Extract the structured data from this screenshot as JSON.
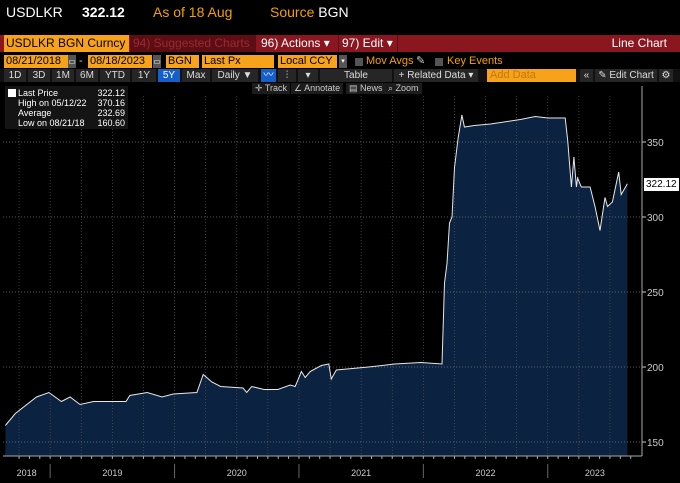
{
  "header": {
    "ticker": "USDLKR",
    "price": "322.12",
    "as_of": "As of 18 Aug",
    "source_label": "Source",
    "source": "BGN"
  },
  "toolbar": {
    "security": "USDLKR BGN Curncy",
    "suggested": "94) Suggested Charts",
    "actions": "96) Actions ▾",
    "edit": "97) Edit ▾",
    "chart_type": "Line Chart"
  },
  "controls": {
    "start_date": "08/21/2018",
    "dash": "-",
    "end_date": "08/18/2023",
    "source": "BGN",
    "field": "Last Px",
    "currency": "Local CCY",
    "mov_avgs": "Mov Avgs",
    "key_events": "Key Events"
  },
  "periods": [
    "1D",
    "3D",
    "1M",
    "6M",
    "YTD",
    "1Y",
    "5Y",
    "Max"
  ],
  "selected_period": "5Y",
  "range_controls": {
    "frequency": "Daily ▼",
    "table": "Table",
    "related": "+ Related Data ▾",
    "add_data_placeholder": "Add Data",
    "collapse": "«",
    "edit_chart": "✎ Edit Chart"
  },
  "tools": {
    "track": "Track",
    "annotate": "Annotate",
    "news": "News",
    "zoom": "Zoom"
  },
  "legend": [
    {
      "label": "Last Price",
      "value": "322.12"
    },
    {
      "label": "High on 05/12/22",
      "value": "370.16"
    },
    {
      "label": "Average",
      "value": "232.69"
    },
    {
      "label": "Low on 08/21/18",
      "value": "160.60"
    }
  ],
  "last_tag": "322.12",
  "colors": {
    "orange": "#f7a21b",
    "red": "#8a1620",
    "fill": "#0b2240",
    "line": "#e8e8e8",
    "active": "#1560c8"
  },
  "chart_data": {
    "type": "area",
    "title": "USDLKR Last Price",
    "ylim": [
      140,
      380
    ],
    "yticks": [
      150,
      200,
      250,
      300,
      350
    ],
    "ytick_labels": [
      "150",
      "200",
      "250",
      "300",
      "350"
    ],
    "xlim": [
      2018.637,
      2023.64
    ],
    "xtick_labels": [
      "2018",
      "2019",
      "2020",
      "2021",
      "2022",
      "2023"
    ],
    "grid": true,
    "x": [
      2018.64,
      2018.72,
      2018.89,
      2018.99,
      2019.09,
      2019.16,
      2019.24,
      2019.35,
      2019.61,
      2019.64,
      2019.78,
      2019.9,
      2019.99,
      2020.18,
      2020.23,
      2020.3,
      2020.37,
      2020.55,
      2020.58,
      2020.62,
      2020.72,
      2020.83,
      2020.93,
      2020.97,
      2021.02,
      2021.05,
      2021.09,
      2021.18,
      2021.24,
      2021.26,
      2021.3,
      2021.56,
      2021.77,
      2021.98,
      2022.15,
      2022.17,
      2022.19,
      2022.21,
      2022.23,
      2022.25,
      2022.28,
      2022.31,
      2022.33,
      2022.41,
      2022.54,
      2022.78,
      2022.9,
      2023.0,
      2023.14,
      2023.16,
      2023.19,
      2023.21,
      2023.23,
      2023.24,
      2023.27,
      2023.34,
      2023.38,
      2023.42,
      2023.46,
      2023.48,
      2023.52,
      2023.57,
      2023.59,
      2023.64
    ],
    "values": [
      161,
      169,
      180,
      183,
      177,
      180,
      175,
      177,
      177,
      181,
      183,
      180,
      182,
      183,
      195,
      190,
      187,
      186,
      183,
      187,
      185,
      185,
      188,
      187,
      197,
      193,
      197,
      201,
      202,
      192,
      198,
      200,
      202,
      203,
      202,
      256,
      269,
      296,
      300,
      333,
      353,
      368,
      360,
      361,
      362,
      365,
      367,
      366,
      366,
      351,
      320,
      340,
      320,
      326,
      320,
      320,
      307,
      291,
      313,
      307,
      310,
      330,
      315,
      322.12
    ]
  }
}
